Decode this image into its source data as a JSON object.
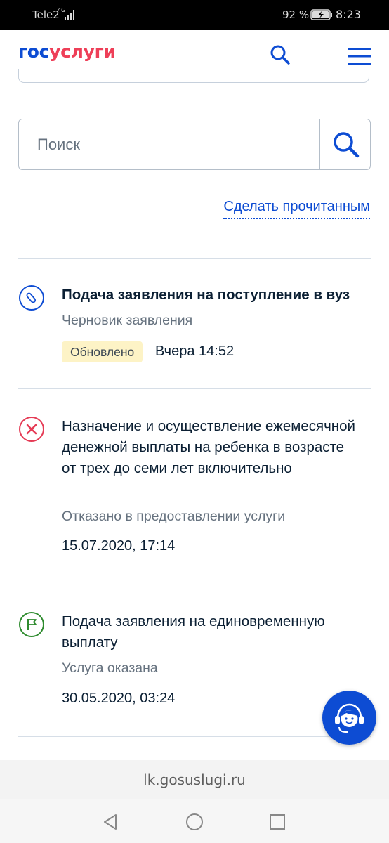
{
  "status_bar": {
    "carrier": "Tele2",
    "network": "4G",
    "battery_percent": "92 %",
    "time": "8:23"
  },
  "header": {
    "logo_part1": "гос",
    "logo_part2": "услуги",
    "search_icon": "search-icon",
    "menu_icon": "hamburger-menu-icon"
  },
  "search": {
    "placeholder": "Поиск",
    "value": ""
  },
  "actions": {
    "mark_read_label": "Сделать прочитанным"
  },
  "notifications": [
    {
      "icon": "paperclip-draft-icon",
      "icon_color": "#0d4cd3",
      "title": "Подача заявления на поступление в вуз",
      "unread": true,
      "status": "Черновик заявления",
      "badge": "Обновлено",
      "date": "Вчера 14:52"
    },
    {
      "icon": "rejected-x-icon",
      "icon_color": "#e53b55",
      "title": "Назначение и осуществление ежемесячной денежной выплаты на ребенка в возрасте от трех до семи лет включительно",
      "unread": false,
      "status": "Отказано в предоставлении услуги",
      "date": "15.07.2020, 17:14"
    },
    {
      "icon": "completed-flag-icon",
      "icon_color": "#2e8b2e",
      "title": "Подача заявления на единовременную выплату",
      "unread": false,
      "status": "Услуга оказана",
      "date": "30.05.2020, 03:24"
    }
  ],
  "support": {
    "icon": "support-operator-icon"
  },
  "browser": {
    "url": "lk.gosuslugi.ru"
  },
  "colors": {
    "brand_blue": "#0d4cd3",
    "brand_red": "#ee3f58",
    "badge_bg": "#fdf3c6"
  }
}
